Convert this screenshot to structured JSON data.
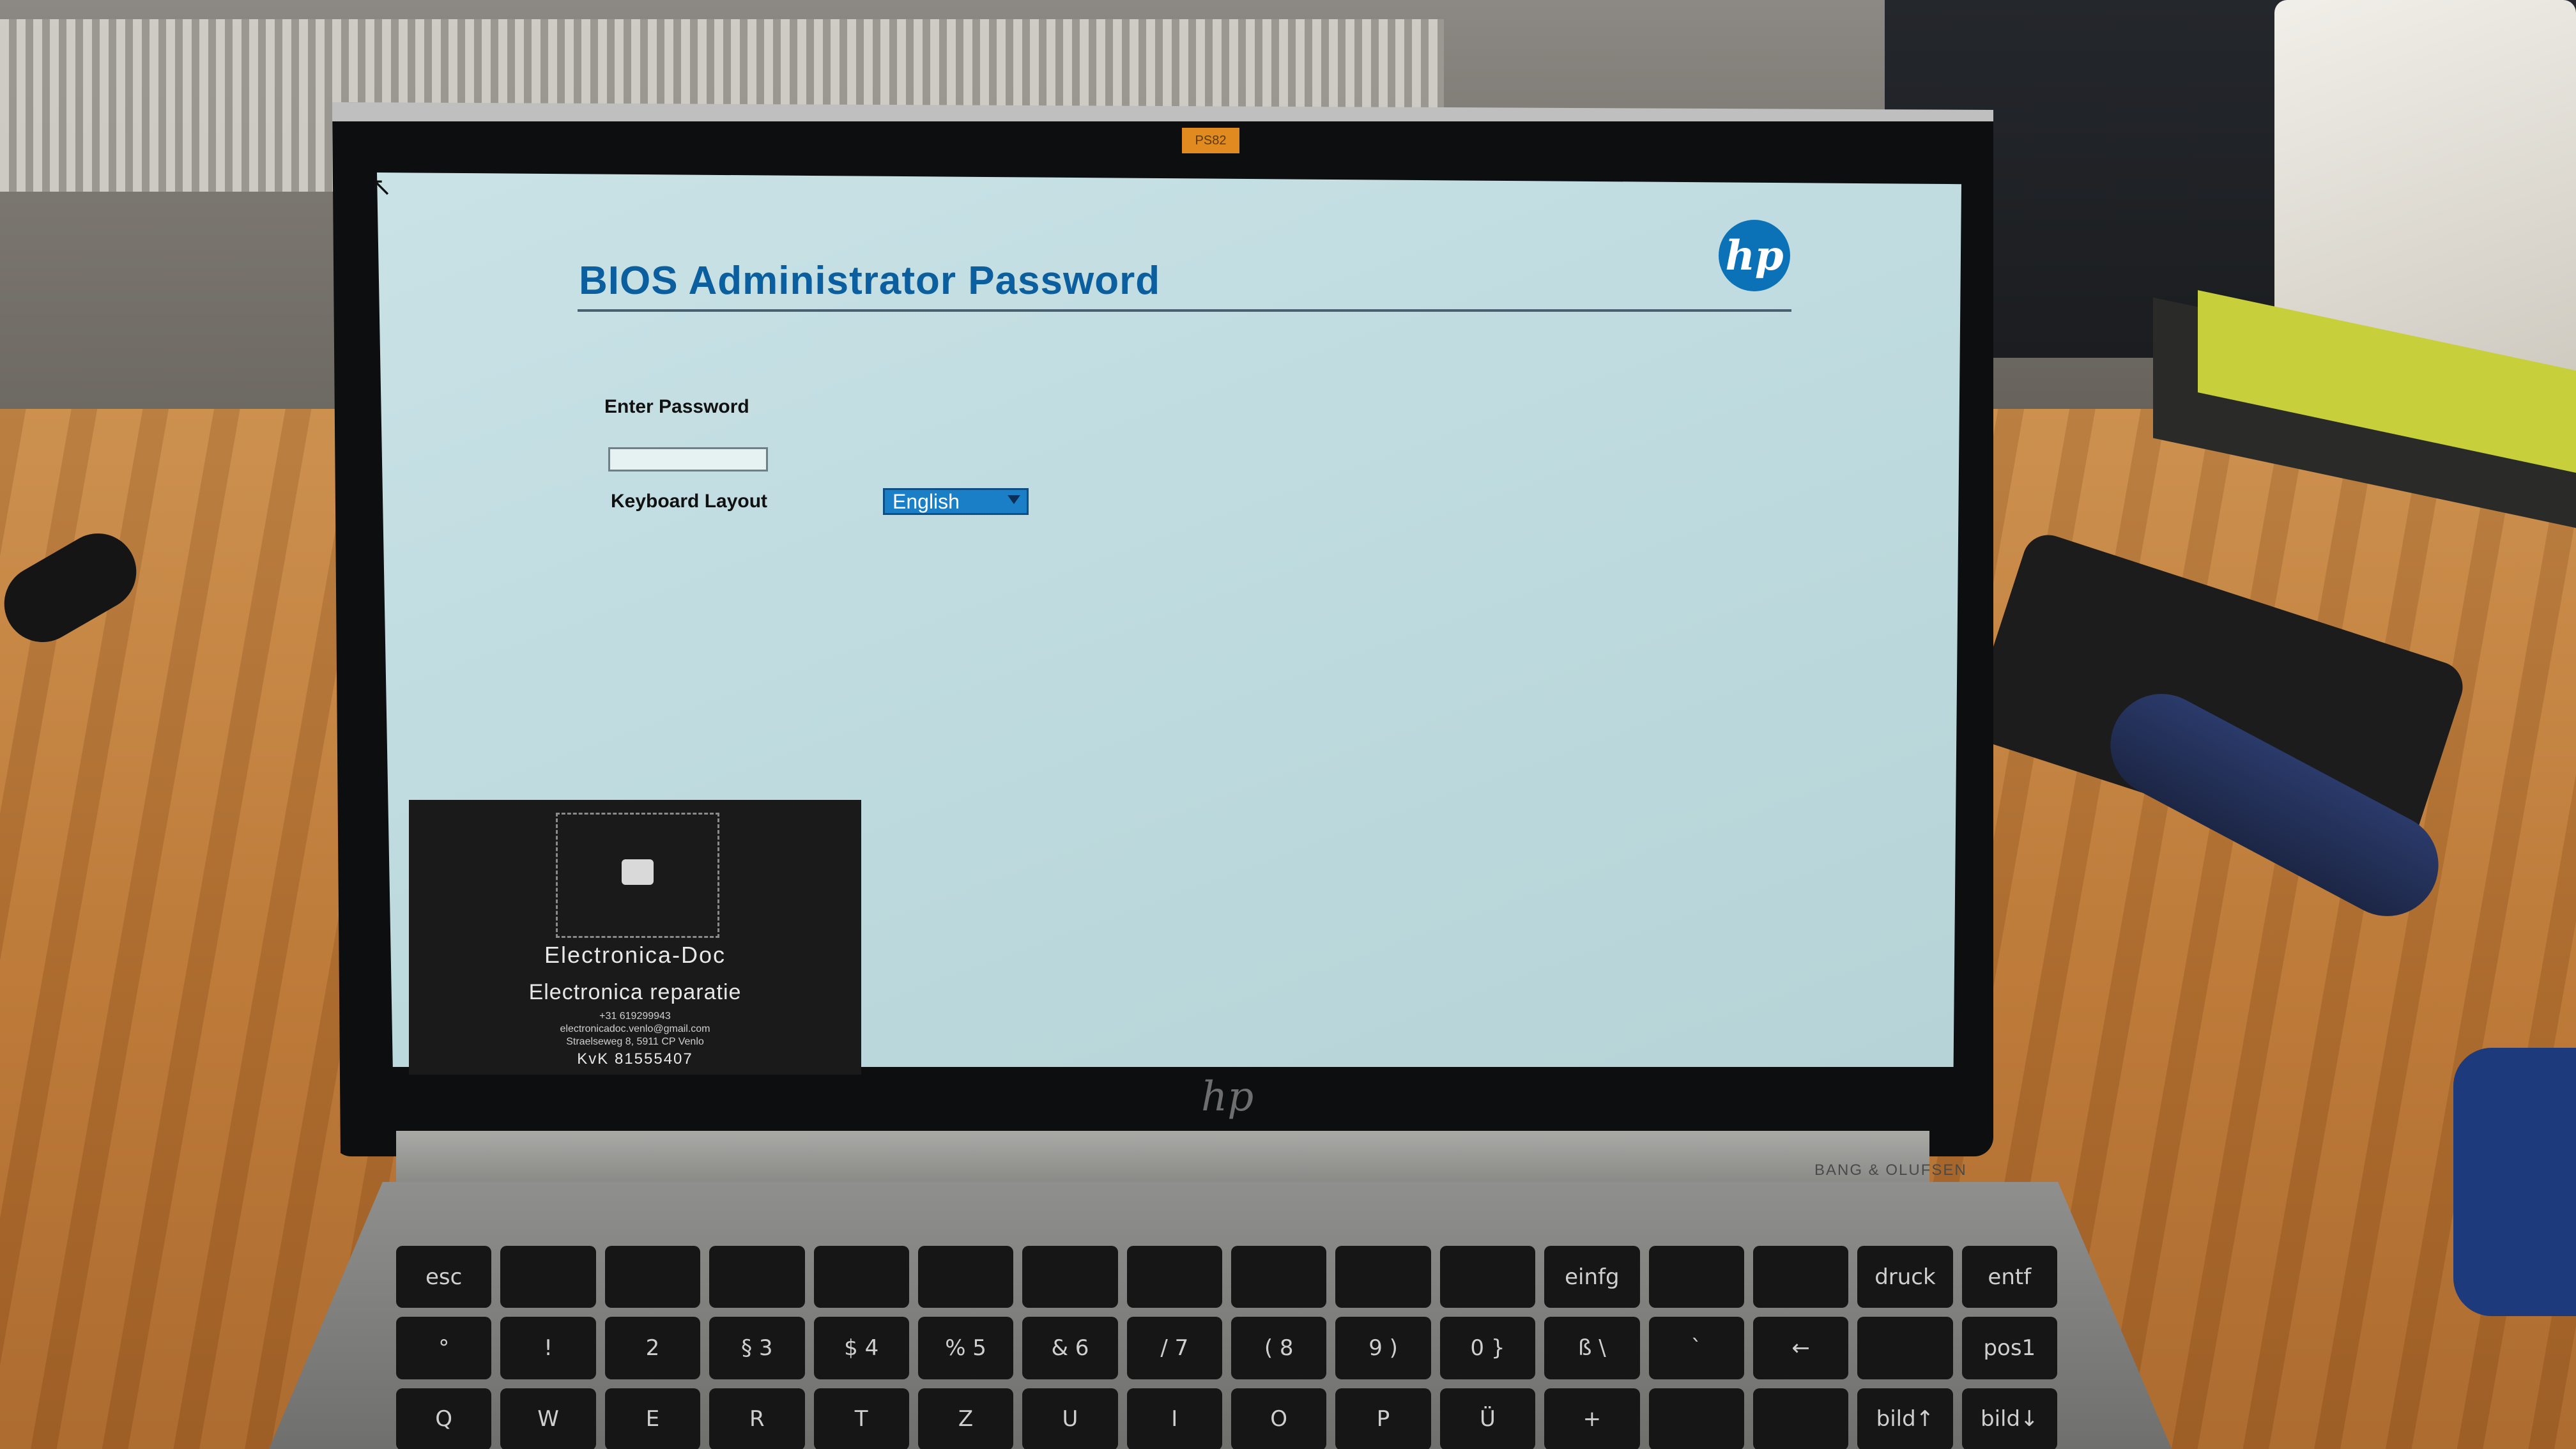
{
  "bios": {
    "title": "BIOS Administrator Password",
    "brand_logo": "hp",
    "password_label": "Enter Password",
    "password_value": "",
    "keyboard_label": "Keyboard Layout",
    "keyboard_selected": "English"
  },
  "watermark": {
    "name": "Electronica-Doc",
    "tagline": "Electronica reparatie",
    "phone": "+31 619299943",
    "email": "electronicadoc.venlo@gmail.com",
    "address": "Straelseweg 8, 5911 CP Venlo",
    "kvk": "KvK 81555407"
  },
  "laptop": {
    "bezel_logo": "hp",
    "brand_strip": "BANG & OLUFSEN",
    "camera_tape": "PS82"
  },
  "keyboard": {
    "keys": [
      "esc",
      "",
      "",
      "",
      "",
      "",
      "",
      "",
      "",
      "",
      "",
      "einfg",
      "",
      "",
      "druck",
      "entf",
      "°",
      "!",
      "2",
      "§ 3",
      "$ 4",
      "% 5",
      "& 6",
      "/ 7",
      "( 8",
      "9 )",
      "0 }",
      "ß \\",
      "`",
      "←",
      "",
      "pos1",
      "Q",
      "W",
      "E",
      "R",
      "T",
      "Z",
      "U",
      "I",
      "O",
      "P",
      "Ü",
      "+",
      "",
      "",
      "bild↑",
      "bild↓"
    ]
  },
  "colors": {
    "title_blue": "#0b5f9e",
    "screen_bg": "#c9e2e6",
    "select_blue": "#1a7fc7",
    "hp_blue": "#0b72b8"
  }
}
